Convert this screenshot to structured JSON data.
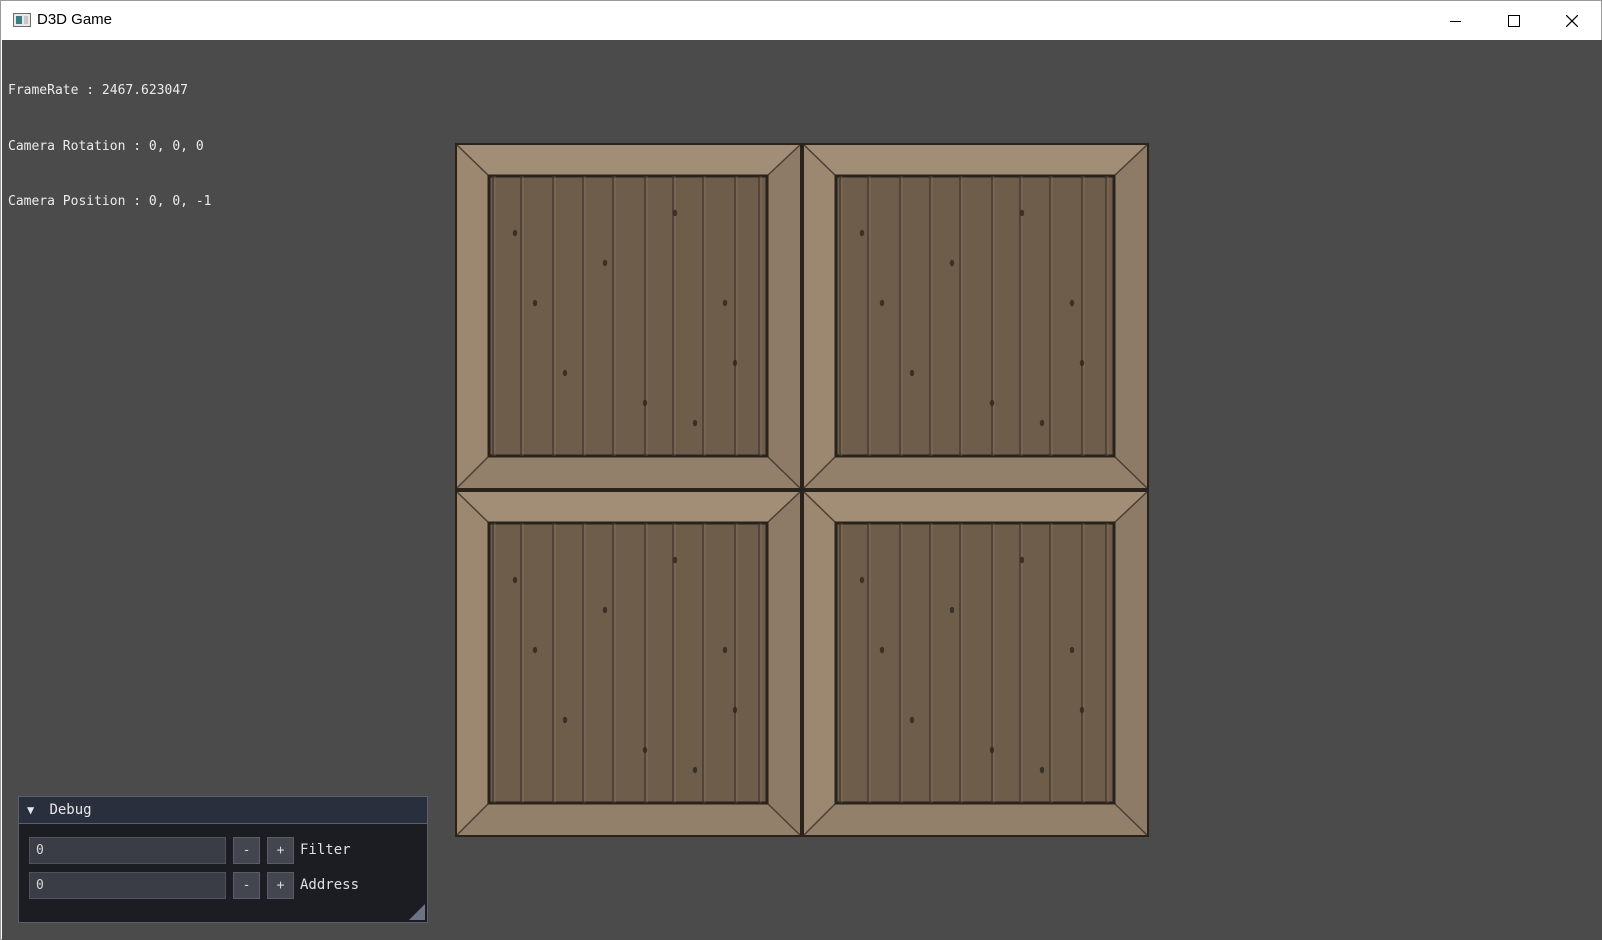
{
  "window": {
    "title": "D3D Game",
    "icons": [
      "app-icon",
      "minimize-icon",
      "maximize-icon",
      "close-icon"
    ]
  },
  "overlay": {
    "framerate": "FrameRate : 2467.623047",
    "camera_rotation": "Camera Rotation : 0, 0, 0",
    "camera_position": "Camera Position : 0, 0, -1"
  },
  "scene": {
    "crate_tiles": 4,
    "background_color": "#4b4b4b"
  },
  "debug_panel": {
    "title": "Debug",
    "rows": [
      {
        "value": "0",
        "minus": "-",
        "plus": "+",
        "label": "Filter"
      },
      {
        "value": "0",
        "minus": "-",
        "plus": "+",
        "label": "Address"
      }
    ]
  }
}
